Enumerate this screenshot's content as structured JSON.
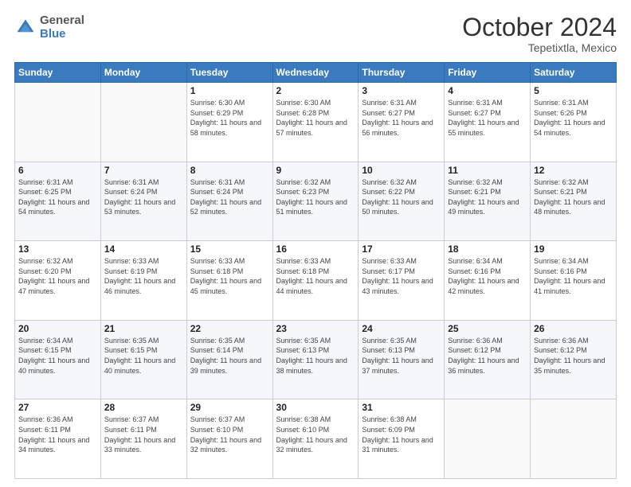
{
  "header": {
    "logo": {
      "general": "General",
      "blue": "Blue"
    },
    "month": "October 2024",
    "location": "Tepetixtla, Mexico"
  },
  "weekdays": [
    "Sunday",
    "Monday",
    "Tuesday",
    "Wednesday",
    "Thursday",
    "Friday",
    "Saturday"
  ],
  "weeks": [
    [
      {
        "day": "",
        "sunrise": "",
        "sunset": "",
        "daylight": ""
      },
      {
        "day": "",
        "sunrise": "",
        "sunset": "",
        "daylight": ""
      },
      {
        "day": "1",
        "sunrise": "Sunrise: 6:30 AM",
        "sunset": "Sunset: 6:29 PM",
        "daylight": "Daylight: 11 hours and 58 minutes."
      },
      {
        "day": "2",
        "sunrise": "Sunrise: 6:30 AM",
        "sunset": "Sunset: 6:28 PM",
        "daylight": "Daylight: 11 hours and 57 minutes."
      },
      {
        "day": "3",
        "sunrise": "Sunrise: 6:31 AM",
        "sunset": "Sunset: 6:27 PM",
        "daylight": "Daylight: 11 hours and 56 minutes."
      },
      {
        "day": "4",
        "sunrise": "Sunrise: 6:31 AM",
        "sunset": "Sunset: 6:27 PM",
        "daylight": "Daylight: 11 hours and 55 minutes."
      },
      {
        "day": "5",
        "sunrise": "Sunrise: 6:31 AM",
        "sunset": "Sunset: 6:26 PM",
        "daylight": "Daylight: 11 hours and 54 minutes."
      }
    ],
    [
      {
        "day": "6",
        "sunrise": "Sunrise: 6:31 AM",
        "sunset": "Sunset: 6:25 PM",
        "daylight": "Daylight: 11 hours and 54 minutes."
      },
      {
        "day": "7",
        "sunrise": "Sunrise: 6:31 AM",
        "sunset": "Sunset: 6:24 PM",
        "daylight": "Daylight: 11 hours and 53 minutes."
      },
      {
        "day": "8",
        "sunrise": "Sunrise: 6:31 AM",
        "sunset": "Sunset: 6:24 PM",
        "daylight": "Daylight: 11 hours and 52 minutes."
      },
      {
        "day": "9",
        "sunrise": "Sunrise: 6:32 AM",
        "sunset": "Sunset: 6:23 PM",
        "daylight": "Daylight: 11 hours and 51 minutes."
      },
      {
        "day": "10",
        "sunrise": "Sunrise: 6:32 AM",
        "sunset": "Sunset: 6:22 PM",
        "daylight": "Daylight: 11 hours and 50 minutes."
      },
      {
        "day": "11",
        "sunrise": "Sunrise: 6:32 AM",
        "sunset": "Sunset: 6:21 PM",
        "daylight": "Daylight: 11 hours and 49 minutes."
      },
      {
        "day": "12",
        "sunrise": "Sunrise: 6:32 AM",
        "sunset": "Sunset: 6:21 PM",
        "daylight": "Daylight: 11 hours and 48 minutes."
      }
    ],
    [
      {
        "day": "13",
        "sunrise": "Sunrise: 6:32 AM",
        "sunset": "Sunset: 6:20 PM",
        "daylight": "Daylight: 11 hours and 47 minutes."
      },
      {
        "day": "14",
        "sunrise": "Sunrise: 6:33 AM",
        "sunset": "Sunset: 6:19 PM",
        "daylight": "Daylight: 11 hours and 46 minutes."
      },
      {
        "day": "15",
        "sunrise": "Sunrise: 6:33 AM",
        "sunset": "Sunset: 6:18 PM",
        "daylight": "Daylight: 11 hours and 45 minutes."
      },
      {
        "day": "16",
        "sunrise": "Sunrise: 6:33 AM",
        "sunset": "Sunset: 6:18 PM",
        "daylight": "Daylight: 11 hours and 44 minutes."
      },
      {
        "day": "17",
        "sunrise": "Sunrise: 6:33 AM",
        "sunset": "Sunset: 6:17 PM",
        "daylight": "Daylight: 11 hours and 43 minutes."
      },
      {
        "day": "18",
        "sunrise": "Sunrise: 6:34 AM",
        "sunset": "Sunset: 6:16 PM",
        "daylight": "Daylight: 11 hours and 42 minutes."
      },
      {
        "day": "19",
        "sunrise": "Sunrise: 6:34 AM",
        "sunset": "Sunset: 6:16 PM",
        "daylight": "Daylight: 11 hours and 41 minutes."
      }
    ],
    [
      {
        "day": "20",
        "sunrise": "Sunrise: 6:34 AM",
        "sunset": "Sunset: 6:15 PM",
        "daylight": "Daylight: 11 hours and 40 minutes."
      },
      {
        "day": "21",
        "sunrise": "Sunrise: 6:35 AM",
        "sunset": "Sunset: 6:15 PM",
        "daylight": "Daylight: 11 hours and 40 minutes."
      },
      {
        "day": "22",
        "sunrise": "Sunrise: 6:35 AM",
        "sunset": "Sunset: 6:14 PM",
        "daylight": "Daylight: 11 hours and 39 minutes."
      },
      {
        "day": "23",
        "sunrise": "Sunrise: 6:35 AM",
        "sunset": "Sunset: 6:13 PM",
        "daylight": "Daylight: 11 hours and 38 minutes."
      },
      {
        "day": "24",
        "sunrise": "Sunrise: 6:35 AM",
        "sunset": "Sunset: 6:13 PM",
        "daylight": "Daylight: 11 hours and 37 minutes."
      },
      {
        "day": "25",
        "sunrise": "Sunrise: 6:36 AM",
        "sunset": "Sunset: 6:12 PM",
        "daylight": "Daylight: 11 hours and 36 minutes."
      },
      {
        "day": "26",
        "sunrise": "Sunrise: 6:36 AM",
        "sunset": "Sunset: 6:12 PM",
        "daylight": "Daylight: 11 hours and 35 minutes."
      }
    ],
    [
      {
        "day": "27",
        "sunrise": "Sunrise: 6:36 AM",
        "sunset": "Sunset: 6:11 PM",
        "daylight": "Daylight: 11 hours and 34 minutes."
      },
      {
        "day": "28",
        "sunrise": "Sunrise: 6:37 AM",
        "sunset": "Sunset: 6:11 PM",
        "daylight": "Daylight: 11 hours and 33 minutes."
      },
      {
        "day": "29",
        "sunrise": "Sunrise: 6:37 AM",
        "sunset": "Sunset: 6:10 PM",
        "daylight": "Daylight: 11 hours and 32 minutes."
      },
      {
        "day": "30",
        "sunrise": "Sunrise: 6:38 AM",
        "sunset": "Sunset: 6:10 PM",
        "daylight": "Daylight: 11 hours and 32 minutes."
      },
      {
        "day": "31",
        "sunrise": "Sunrise: 6:38 AM",
        "sunset": "Sunset: 6:09 PM",
        "daylight": "Daylight: 11 hours and 31 minutes."
      },
      {
        "day": "",
        "sunrise": "",
        "sunset": "",
        "daylight": ""
      },
      {
        "day": "",
        "sunrise": "",
        "sunset": "",
        "daylight": ""
      }
    ]
  ]
}
